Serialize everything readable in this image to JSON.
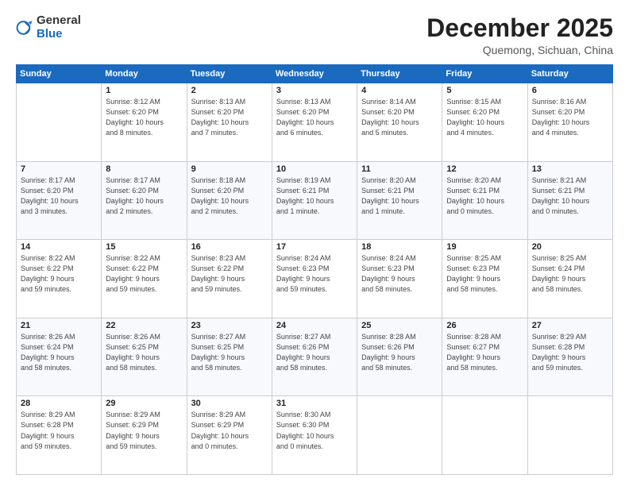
{
  "header": {
    "logo_general": "General",
    "logo_blue": "Blue",
    "month_year": "December 2025",
    "location": "Quemong, Sichuan, China"
  },
  "days_of_week": [
    "Sunday",
    "Monday",
    "Tuesday",
    "Wednesday",
    "Thursday",
    "Friday",
    "Saturday"
  ],
  "weeks": [
    [
      {
        "day": "",
        "info": ""
      },
      {
        "day": "1",
        "info": "Sunrise: 8:12 AM\nSunset: 6:20 PM\nDaylight: 10 hours\nand 8 minutes."
      },
      {
        "day": "2",
        "info": "Sunrise: 8:13 AM\nSunset: 6:20 PM\nDaylight: 10 hours\nand 7 minutes."
      },
      {
        "day": "3",
        "info": "Sunrise: 8:13 AM\nSunset: 6:20 PM\nDaylight: 10 hours\nand 6 minutes."
      },
      {
        "day": "4",
        "info": "Sunrise: 8:14 AM\nSunset: 6:20 PM\nDaylight: 10 hours\nand 5 minutes."
      },
      {
        "day": "5",
        "info": "Sunrise: 8:15 AM\nSunset: 6:20 PM\nDaylight: 10 hours\nand 4 minutes."
      },
      {
        "day": "6",
        "info": "Sunrise: 8:16 AM\nSunset: 6:20 PM\nDaylight: 10 hours\nand 4 minutes."
      }
    ],
    [
      {
        "day": "7",
        "info": "Sunrise: 8:17 AM\nSunset: 6:20 PM\nDaylight: 10 hours\nand 3 minutes."
      },
      {
        "day": "8",
        "info": "Sunrise: 8:17 AM\nSunset: 6:20 PM\nDaylight: 10 hours\nand 2 minutes."
      },
      {
        "day": "9",
        "info": "Sunrise: 8:18 AM\nSunset: 6:20 PM\nDaylight: 10 hours\nand 2 minutes."
      },
      {
        "day": "10",
        "info": "Sunrise: 8:19 AM\nSunset: 6:21 PM\nDaylight: 10 hours\nand 1 minute."
      },
      {
        "day": "11",
        "info": "Sunrise: 8:20 AM\nSunset: 6:21 PM\nDaylight: 10 hours\nand 1 minute."
      },
      {
        "day": "12",
        "info": "Sunrise: 8:20 AM\nSunset: 6:21 PM\nDaylight: 10 hours\nand 0 minutes."
      },
      {
        "day": "13",
        "info": "Sunrise: 8:21 AM\nSunset: 6:21 PM\nDaylight: 10 hours\nand 0 minutes."
      }
    ],
    [
      {
        "day": "14",
        "info": "Sunrise: 8:22 AM\nSunset: 6:22 PM\nDaylight: 9 hours\nand 59 minutes."
      },
      {
        "day": "15",
        "info": "Sunrise: 8:22 AM\nSunset: 6:22 PM\nDaylight: 9 hours\nand 59 minutes."
      },
      {
        "day": "16",
        "info": "Sunrise: 8:23 AM\nSunset: 6:22 PM\nDaylight: 9 hours\nand 59 minutes."
      },
      {
        "day": "17",
        "info": "Sunrise: 8:24 AM\nSunset: 6:23 PM\nDaylight: 9 hours\nand 59 minutes."
      },
      {
        "day": "18",
        "info": "Sunrise: 8:24 AM\nSunset: 6:23 PM\nDaylight: 9 hours\nand 58 minutes."
      },
      {
        "day": "19",
        "info": "Sunrise: 8:25 AM\nSunset: 6:23 PM\nDaylight: 9 hours\nand 58 minutes."
      },
      {
        "day": "20",
        "info": "Sunrise: 8:25 AM\nSunset: 6:24 PM\nDaylight: 9 hours\nand 58 minutes."
      }
    ],
    [
      {
        "day": "21",
        "info": "Sunrise: 8:26 AM\nSunset: 6:24 PM\nDaylight: 9 hours\nand 58 minutes."
      },
      {
        "day": "22",
        "info": "Sunrise: 8:26 AM\nSunset: 6:25 PM\nDaylight: 9 hours\nand 58 minutes."
      },
      {
        "day": "23",
        "info": "Sunrise: 8:27 AM\nSunset: 6:25 PM\nDaylight: 9 hours\nand 58 minutes."
      },
      {
        "day": "24",
        "info": "Sunrise: 8:27 AM\nSunset: 6:26 PM\nDaylight: 9 hours\nand 58 minutes."
      },
      {
        "day": "25",
        "info": "Sunrise: 8:28 AM\nSunset: 6:26 PM\nDaylight: 9 hours\nand 58 minutes."
      },
      {
        "day": "26",
        "info": "Sunrise: 8:28 AM\nSunset: 6:27 PM\nDaylight: 9 hours\nand 58 minutes."
      },
      {
        "day": "27",
        "info": "Sunrise: 8:29 AM\nSunset: 6:28 PM\nDaylight: 9 hours\nand 59 minutes."
      }
    ],
    [
      {
        "day": "28",
        "info": "Sunrise: 8:29 AM\nSunset: 6:28 PM\nDaylight: 9 hours\nand 59 minutes."
      },
      {
        "day": "29",
        "info": "Sunrise: 8:29 AM\nSunset: 6:29 PM\nDaylight: 9 hours\nand 59 minutes."
      },
      {
        "day": "30",
        "info": "Sunrise: 8:29 AM\nSunset: 6:29 PM\nDaylight: 10 hours\nand 0 minutes."
      },
      {
        "day": "31",
        "info": "Sunrise: 8:30 AM\nSunset: 6:30 PM\nDaylight: 10 hours\nand 0 minutes."
      },
      {
        "day": "",
        "info": ""
      },
      {
        "day": "",
        "info": ""
      },
      {
        "day": "",
        "info": ""
      }
    ]
  ]
}
